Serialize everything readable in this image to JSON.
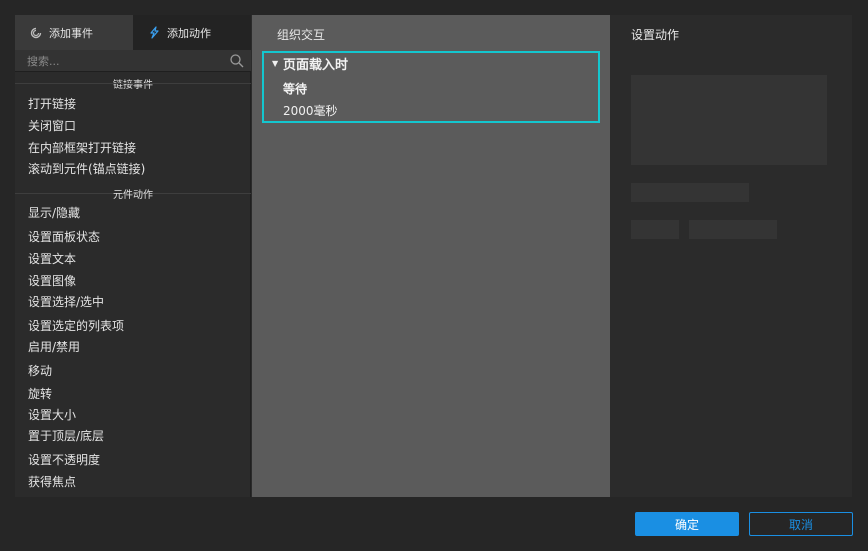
{
  "tabs": {
    "add_event": "添加事件",
    "add_action": "添加动作"
  },
  "search": {
    "placeholder": "搜索..."
  },
  "sections": {
    "link_events": "链接事件",
    "widget_actions": "元件动作"
  },
  "link_items": [
    "打开链接",
    "关闭窗口",
    "在内部框架打开链接",
    "滚动到元件(锚点链接)"
  ],
  "widget_items": [
    "显示/隐藏",
    "设置面板状态",
    "设置文本",
    "设置图像",
    "设置选择/选中",
    "设置选定的列表项",
    "启用/禁用",
    "移动",
    "旋转",
    "设置大小",
    "置于顶层/底层",
    "设置不透明度",
    "获得焦点"
  ],
  "middle": {
    "title": "组织交互",
    "event": {
      "title": "页面载入时",
      "action": "等待",
      "value": "2000毫秒"
    }
  },
  "right": {
    "title": "设置动作"
  },
  "buttons": {
    "ok": "确定",
    "cancel": "取消"
  },
  "colors": {
    "accent": "#1a8fe3",
    "selection_border": "#14c6cf",
    "middle_bg": "#5b5b5b"
  },
  "icons": {
    "add_event": "event-swirl-icon",
    "add_action": "lightning-action-icon",
    "search": "search-icon",
    "expand": "triangle-down-icon"
  }
}
